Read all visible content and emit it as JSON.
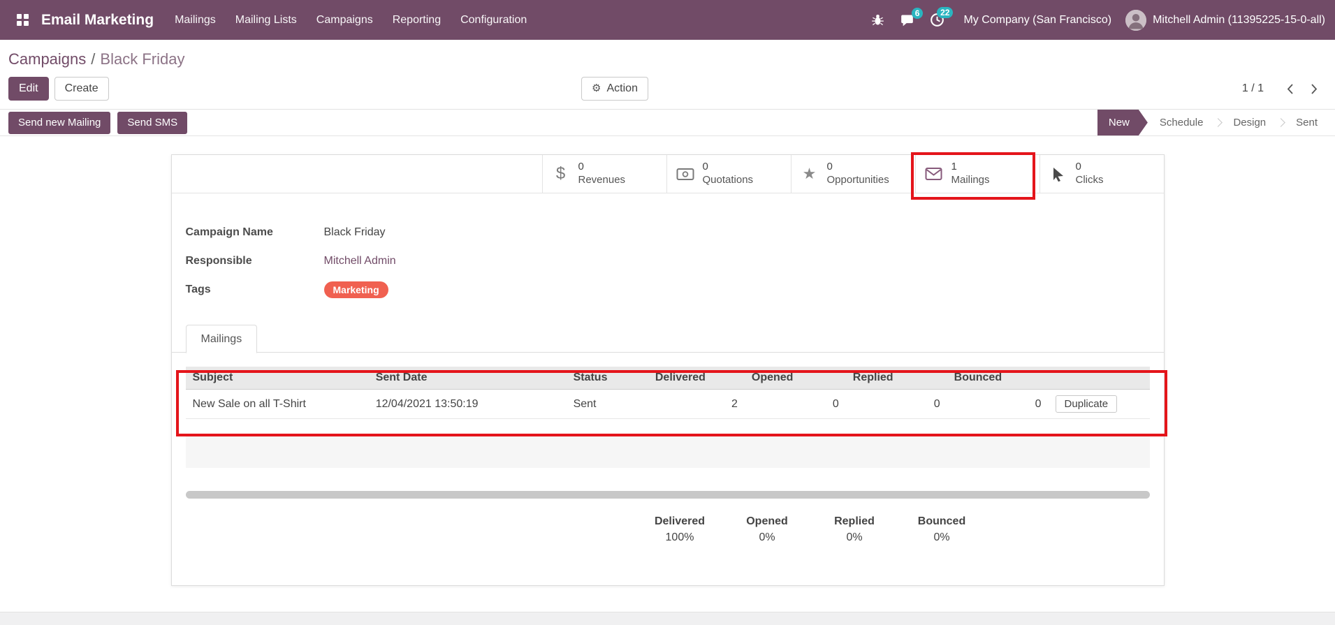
{
  "colors": {
    "primary": "#714B67",
    "tag": "#F06050",
    "notification_badge": "#2AB5C0",
    "annotation": "#E4151B"
  },
  "nav": {
    "app_name": "Email Marketing",
    "menus": [
      "Mailings",
      "Mailing Lists",
      "Campaigns",
      "Reporting",
      "Configuration"
    ],
    "icons": [
      "debug-icon",
      "chat-icon",
      "clock-icon"
    ],
    "messages_badge": "6",
    "activities_badge": "22",
    "company": "My Company (San Francisco)",
    "user": "Mitchell Admin (11395225-15-0-all)"
  },
  "breadcrumb": {
    "parent": "Campaigns",
    "separator": "/",
    "current": "Black Friday"
  },
  "control_panel": {
    "edit": "Edit",
    "create": "Create",
    "action": "Action",
    "pager": "1 / 1"
  },
  "statusbar": {
    "send_new_mailing": "Send new Mailing",
    "send_sms": "Send SMS",
    "stages": [
      {
        "label": "New",
        "active": true
      },
      {
        "label": "Schedule",
        "active": false
      },
      {
        "label": "Design",
        "active": false
      },
      {
        "label": "Sent",
        "active": false
      }
    ]
  },
  "buttonbox": [
    {
      "icon": "dollar-icon",
      "value": "0",
      "label": "Revenues"
    },
    {
      "icon": "money-icon",
      "value": "0",
      "label": "Quotations"
    },
    {
      "icon": "star-icon",
      "value": "0",
      "label": "Opportunities"
    },
    {
      "icon": "envelope-icon",
      "value": "1",
      "label": "Mailings"
    },
    {
      "icon": "cursor-icon",
      "value": "0",
      "label": "Clicks"
    }
  ],
  "form": {
    "campaign_name": {
      "label": "Campaign Name",
      "value": "Black Friday"
    },
    "responsible": {
      "label": "Responsible",
      "value": "Mitchell Admin"
    },
    "tags": {
      "label": "Tags",
      "value": "Marketing"
    }
  },
  "tabs": [
    {
      "label": "Mailings",
      "active": true
    }
  ],
  "mailings_table": {
    "headers": [
      "Subject",
      "Sent Date",
      "Status",
      "Delivered",
      "Opened",
      "Replied",
      "Bounced",
      ""
    ],
    "rows": [
      {
        "subject": "New Sale on all T-Shirt",
        "sent_date": "12/04/2021 13:50:19",
        "status": "Sent",
        "delivered": "2",
        "opened": "0",
        "replied": "0",
        "bounced": "0",
        "action": "Duplicate"
      }
    ]
  },
  "stats": [
    {
      "label": "Delivered",
      "value": "100%"
    },
    {
      "label": "Opened",
      "value": "0%"
    },
    {
      "label": "Replied",
      "value": "0%"
    },
    {
      "label": "Bounced",
      "value": "0%"
    }
  ]
}
